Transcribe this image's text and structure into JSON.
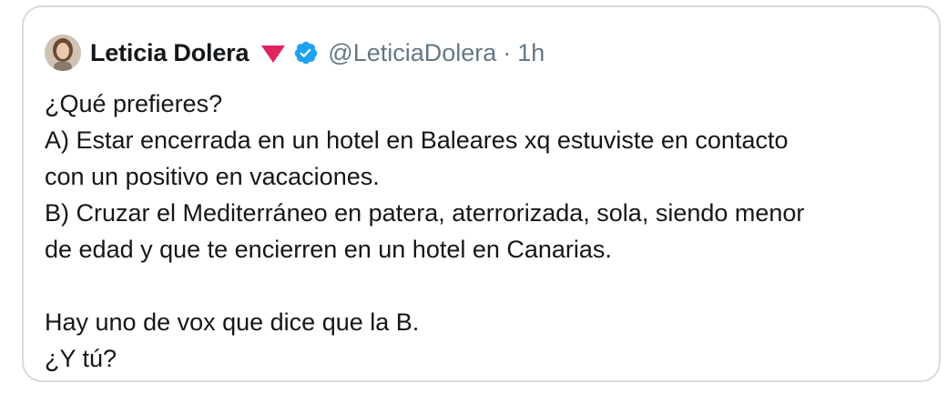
{
  "tweet": {
    "author": {
      "display_name": "Leticia Dolera",
      "handle": "@LeticiaDolera",
      "verified": true,
      "avatar_icon": "profile-photo",
      "badge_icon": "red-triangle-icon"
    },
    "separator": "·",
    "timestamp": "1h",
    "lines": [
      "¿Qué prefieres?",
      "A) Estar encerrada en un hotel en Baleares xq estuviste en contacto",
      "con un positivo en vacaciones.",
      "B) Cruzar el Mediterráneo en patera, aterrorizada, sola, siendo menor",
      "de edad y que te encierren en un hotel en Canarias.",
      "",
      "Hay uno de vox que dice que la B.",
      "¿Y tú?"
    ]
  },
  "colors": {
    "text": "#14171a",
    "secondary": "#657786",
    "verified_blue": "#1da1f2",
    "triangle_red": "#e0245e",
    "border": "#d5dbe0"
  }
}
